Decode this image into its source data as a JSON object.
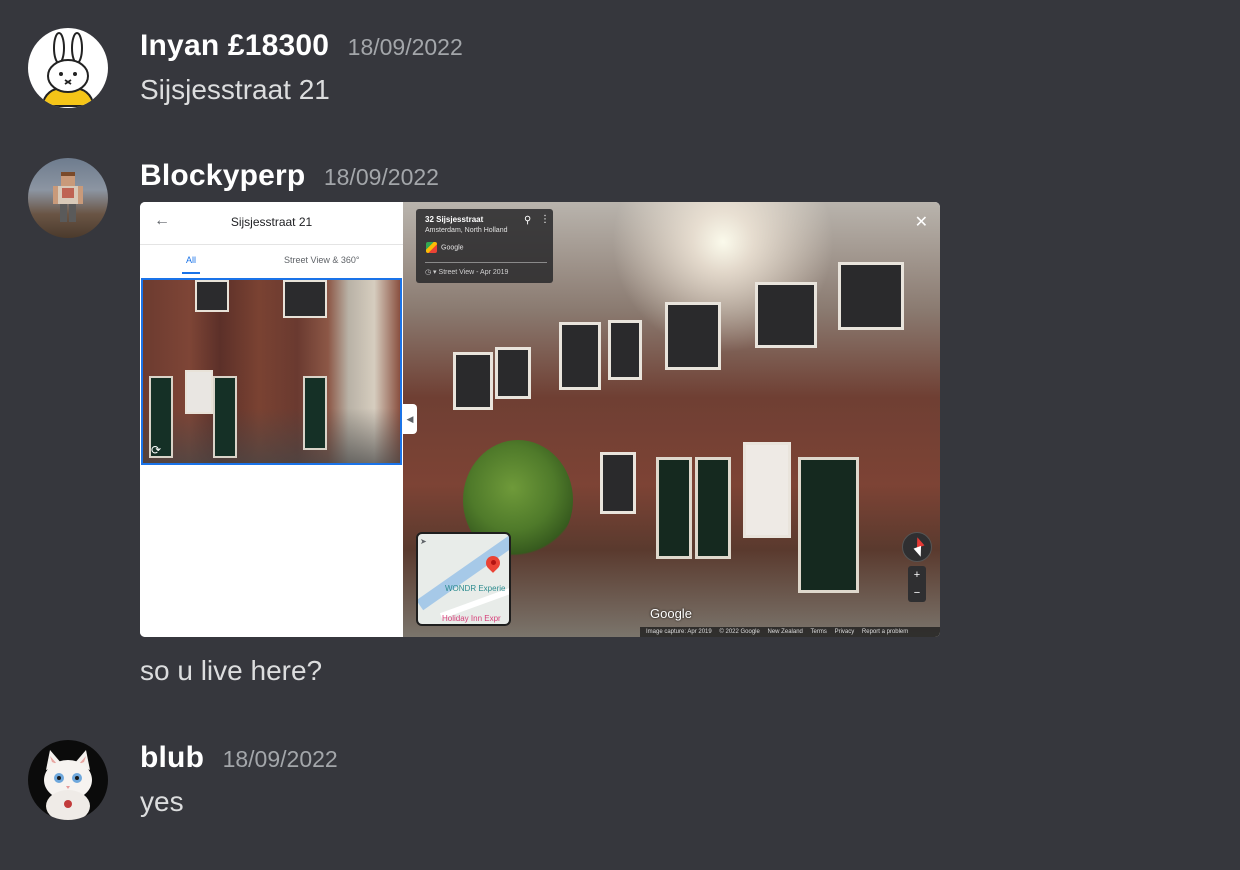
{
  "messages": [
    {
      "username": "Inyan £18300",
      "timestamp": "18/09/2022",
      "text": "Sijsjesstraat 21",
      "avatar": "miffy-bunny-avatar"
    },
    {
      "username": "Blockyperp",
      "timestamp": "18/09/2022",
      "text": "so u live here?",
      "avatar": "minecraft-character-avatar",
      "attachment": {
        "left_panel": {
          "back_icon": "arrow-left-icon",
          "title": "Sijsjesstraat 21",
          "tabs": [
            "All",
            "Street View & 360°"
          ],
          "active_tab": "All"
        },
        "info_card": {
          "address": "32 Sijsjesstraat",
          "locality": "Amsterdam, North Holland",
          "source": "Google",
          "history": "Street View - Apr 2019"
        },
        "minimap": {
          "label1": "WONDR Experie",
          "label2": "Holiday Inn Expr"
        },
        "watermark": "Google",
        "footer": [
          "Image capture: Apr 2019",
          "© 2022 Google",
          "New Zealand",
          "Terms",
          "Privacy",
          "Report a problem"
        ]
      }
    },
    {
      "username": "blub",
      "timestamp": "18/09/2022",
      "text": "yes",
      "avatar": "white-cat-avatar"
    }
  ],
  "colors": {
    "background": "#36373d",
    "username": "#ffffff",
    "timestamp": "#a3a6aa",
    "message_text": "#dcddde"
  }
}
